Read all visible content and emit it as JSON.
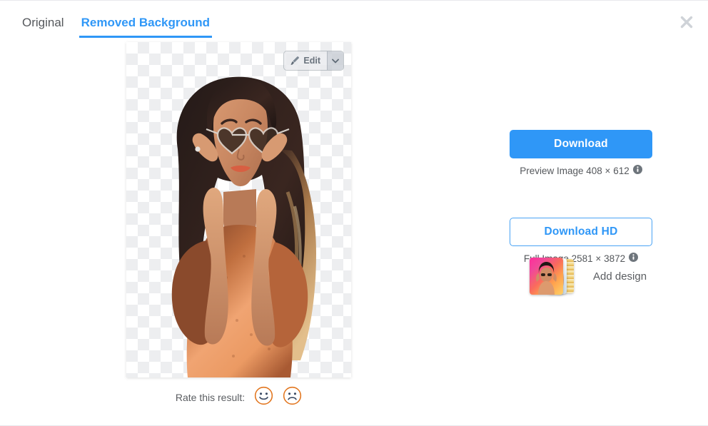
{
  "tabs": [
    {
      "label": "Original",
      "active": false
    },
    {
      "label": "Removed Background",
      "active": true
    }
  ],
  "close_button": {
    "icon": "close-icon",
    "label": "×"
  },
  "preview": {
    "background": "transparent-checkerboard",
    "subject_alt": "Woman with long dark hair wearing an orange patterned dress holding heart-shaped sunglasses",
    "edit_button": {
      "label": "Edit",
      "icon": "brush-icon",
      "dropdown_icon": "chevron-down-icon"
    }
  },
  "rating": {
    "label": "Rate this result:",
    "options": [
      {
        "name": "happy-face",
        "glyph": "☺"
      },
      {
        "name": "sad-face",
        "glyph": "☹"
      }
    ]
  },
  "actions": {
    "download": {
      "label": "Download",
      "meta": "Preview Image 408 × 612",
      "info_icon": "info-icon"
    },
    "download_hd": {
      "label": "Download HD",
      "meta": "Full Image 2581 × 3872",
      "info_icon": "info-icon"
    },
    "add_design": {
      "label": "Add design",
      "thumbnails": [
        "gradient-portrait-thumb",
        "light-blue-thumb",
        "striped-yellow-thumb"
      ]
    }
  },
  "colors": {
    "accent": "#2f97f7",
    "accent_outline": "#49a3f5",
    "text": "#55585c",
    "checker_light": "#ffffff",
    "checker_dark": "#edeef0",
    "face_outline": "#e2761f",
    "close_gray": "#cfd3d8"
  }
}
